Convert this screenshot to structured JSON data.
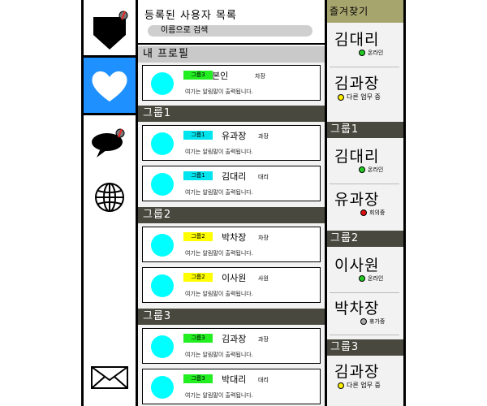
{
  "app": {
    "rail": {
      "items": [
        {
          "icon": "profile-icon"
        },
        {
          "icon": "heart-icon"
        },
        {
          "icon": "chat-icon"
        },
        {
          "icon": "globe-icon"
        },
        {
          "icon": "mail-icon"
        }
      ]
    },
    "list": {
      "title": "등록된 사용자 목록",
      "search_placeholder": "이름으로 검색",
      "profile_section": "내 프로필",
      "profile": {
        "tag": "그룹3",
        "name": "본인",
        "rank": "차장",
        "message": "여기는 알림말이 출력됩니다."
      },
      "groups": [
        {
          "label": "그룹1",
          "members": [
            {
              "tag": "그룹1",
              "name": "유과장",
              "rank": "과장",
              "message": "여기는 알림말이 출력됩니다."
            },
            {
              "tag": "그룹1",
              "name": "김대리",
              "rank": "대리",
              "message": "여기는 알림말이 출력됩니다."
            }
          ]
        },
        {
          "label": "그룹2",
          "members": [
            {
              "tag": "그룹2",
              "name": "박차장",
              "rank": "차장",
              "message": "여기는 알림말이 출력됩니다."
            },
            {
              "tag": "그룹2",
              "name": "이사원",
              "rank": "사원",
              "message": "여기는 알림말이 출력됩니다."
            }
          ]
        },
        {
          "label": "그룹3",
          "members": [
            {
              "tag": "그룹3",
              "name": "김과장",
              "rank": "과장",
              "message": "여기는 알림말이 출력됩니다."
            },
            {
              "tag": "그룹3",
              "name": "박대리",
              "rank": "대리",
              "message": "여기는 알림말이 출력됩니다."
            }
          ]
        }
      ]
    },
    "favorites": {
      "title": "즐겨찾기",
      "top": [
        {
          "name": "김대리",
          "status": "온라인",
          "status_color": "#22cc22"
        },
        {
          "name": "김과장",
          "status": "다른 업무 중",
          "status_color": "#ffee00"
        }
      ],
      "groups": [
        {
          "label": "그룹1",
          "members": [
            {
              "name": "김대리",
              "status": "온라인",
              "status_color": "#22cc22"
            },
            {
              "name": "유과장",
              "status": "회의중",
              "status_color": "#dd1111"
            }
          ]
        },
        {
          "label": "그룹2",
          "members": [
            {
              "name": "이사원",
              "status": "온라인",
              "status_color": "#22cc22"
            },
            {
              "name": "박차장",
              "status": "휴가중",
              "status_color": "#aaaaaa"
            }
          ]
        },
        {
          "label": "그룹3",
          "members": [
            {
              "name": "김과장",
              "status": "다른 업무 중",
              "status_color": "#ffee00"
            }
          ]
        }
      ]
    },
    "colors": {
      "tag_group1": "#00e5ee",
      "tag_group2": "#ffff00",
      "tag_group3": "#22ee22",
      "rail_active": "#1e90ff",
      "section_dark": "#48483e",
      "favorites_header": "#a7a56e"
    }
  }
}
